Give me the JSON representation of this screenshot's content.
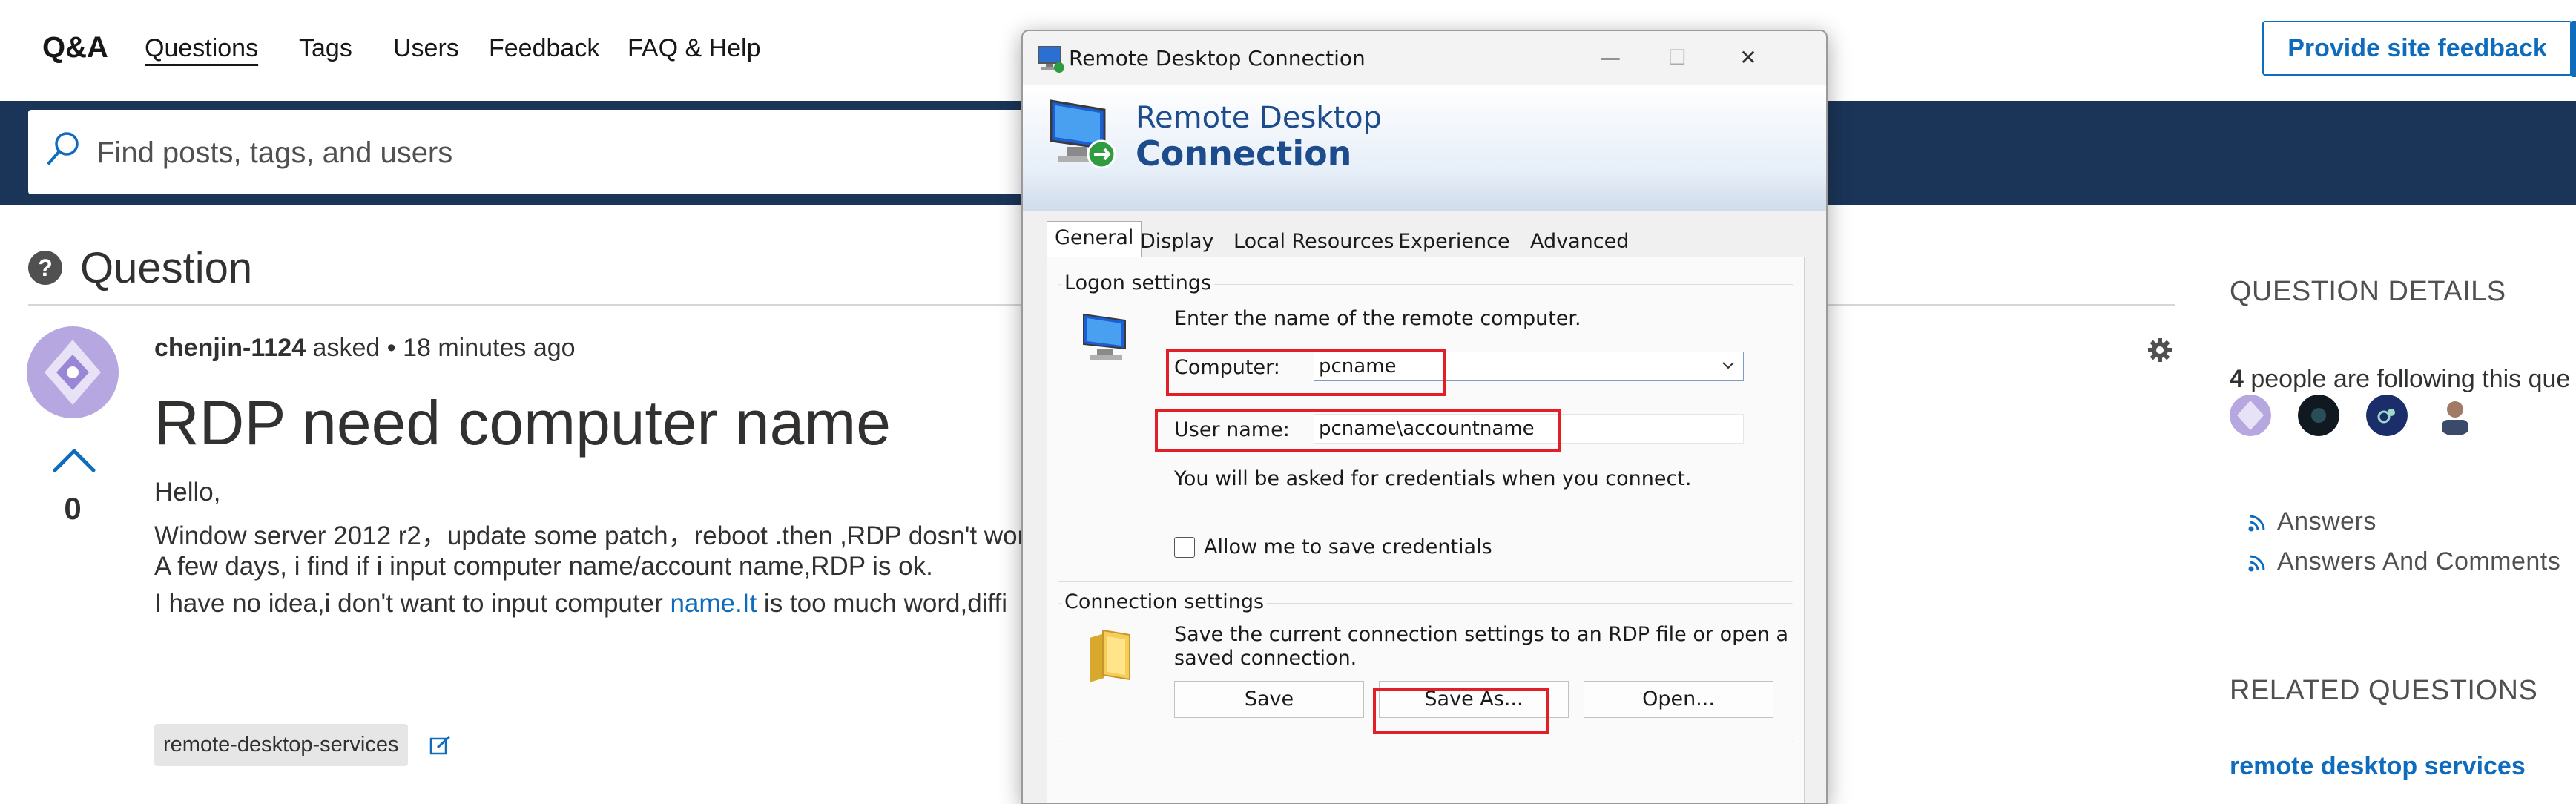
{
  "topnav": {
    "brand": "Q&A",
    "links": [
      "Questions",
      "Tags",
      "Users",
      "Feedback",
      "FAQ & Help"
    ],
    "feedback_button": "Provide site feedback"
  },
  "search": {
    "placeholder": "Find posts, tags, and users"
  },
  "question": {
    "section_title": "Question",
    "author": "chenjin-1124",
    "asked_meta": " asked • 18 minutes ago",
    "title": "RDP need computer name",
    "vote_count": "0",
    "body": [
      "Hello,",
      "Window server 2012 r2，update some patch，reboot .then ,RDP dosn't wor",
      "A few days, i find if i input computer name/account name,RDP is ok.",
      "I have no idea,i don't want to input computer "
    ],
    "body_link": "name.It",
    "body_tail": " is too much word,diffi",
    "tag": "remote-desktop-services"
  },
  "sidebar": {
    "details_title": "QUESTION DETAILS",
    "followers_count": "4",
    "followers_text": " people are following this que",
    "rss": [
      "Answers",
      "Answers And Comments"
    ],
    "related_title": "RELATED QUESTIONS",
    "related_link": "remote desktop services"
  },
  "dialog": {
    "title": "Remote Desktop Connection",
    "header_line1": "Remote Desktop",
    "header_line2": "Connection",
    "tabs": [
      "General",
      "Display",
      "Local Resources",
      "Experience",
      "Advanced"
    ],
    "logon": {
      "group_label": "Logon settings",
      "instruction": "Enter the name of the remote computer.",
      "computer_label": "Computer:",
      "computer_value": "pcname",
      "username_label": "User name:",
      "username_value": "pcname\\accountname",
      "credentials_note": "You will be asked for credentials when you connect.",
      "save_credentials": "Allow me to save credentials"
    },
    "connection": {
      "group_label": "Connection settings",
      "description_line1": "Save the current connection settings to an RDP file or open a",
      "description_line2": "saved connection.",
      "save": "Save",
      "save_as": "Save As...",
      "open": "Open..."
    }
  },
  "colors": {
    "accent": "#0f6cbd",
    "banner": "#1b3558",
    "highlight": "#e21f26",
    "dialog_heading": "#1c4c8c"
  }
}
